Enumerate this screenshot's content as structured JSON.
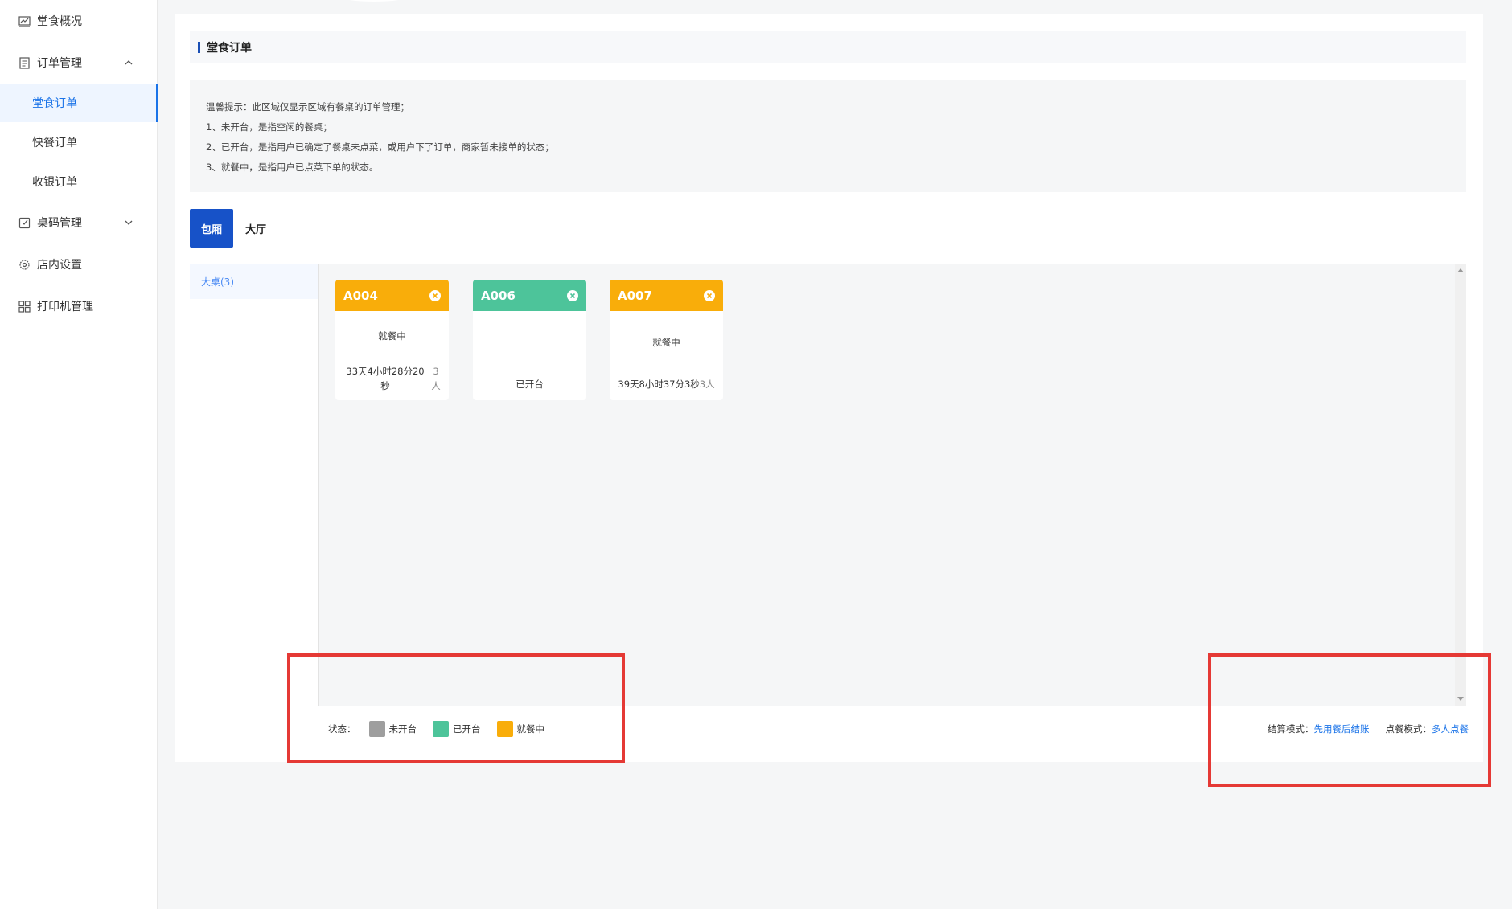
{
  "sidebar": {
    "items": [
      {
        "label": "堂食概况",
        "icon": "chart-icon"
      },
      {
        "label": "订单管理",
        "icon": "document-icon"
      },
      {
        "label": "桌码管理",
        "icon": "qrcode-icon"
      },
      {
        "label": "店内设置",
        "icon": "gear-icon"
      },
      {
        "label": "打印机管理",
        "icon": "grid-icon"
      }
    ],
    "sub_items": [
      {
        "label": "堂食订单",
        "active": true
      },
      {
        "label": "快餐订单",
        "active": false
      },
      {
        "label": "收银订单",
        "active": false
      }
    ]
  },
  "page": {
    "title": "堂食订单"
  },
  "notice": {
    "lines": [
      "温馨提示：此区域仅显示区域有餐桌的订单管理；",
      "1、未开台，是指空闲的餐桌；",
      "2、已开台，是指用户已确定了餐桌未点菜，或用户下了订单，商家暂未接单的状态；",
      "3、就餐中，是指用户已点菜下单的状态。"
    ]
  },
  "tabs": [
    {
      "label": "包厢",
      "active": true
    },
    {
      "label": "大厅",
      "active": false
    }
  ],
  "areas": [
    {
      "label": "大桌(3)"
    }
  ],
  "tables": [
    {
      "code": "A004",
      "status": "就餐中",
      "duration": "33天4小时28分20秒",
      "people": "3人",
      "color": "#f9ad0a"
    },
    {
      "code": "A006",
      "status": "已开台",
      "duration": "",
      "people": "",
      "color": "#4dc49a"
    },
    {
      "code": "A007",
      "status": "就餐中",
      "duration": "39天8小时37分3秒",
      "people": "3人",
      "color": "#f9ad0a"
    }
  ],
  "legend": {
    "label": "状态：",
    "items": [
      {
        "label": "未开台",
        "color": "#9e9e9e"
      },
      {
        "label": "已开台",
        "color": "#4dc49a"
      },
      {
        "label": "就餐中",
        "color": "#f9ad0a"
      }
    ]
  },
  "modes": {
    "settle_label": "结算模式：",
    "settle_value": "先用餐后结账",
    "order_label": "点餐模式：",
    "order_value": "多人点餐"
  },
  "accent_colors": {
    "primary": "#1752c8",
    "link": "#1a73e8",
    "highlight": "#e53935"
  }
}
